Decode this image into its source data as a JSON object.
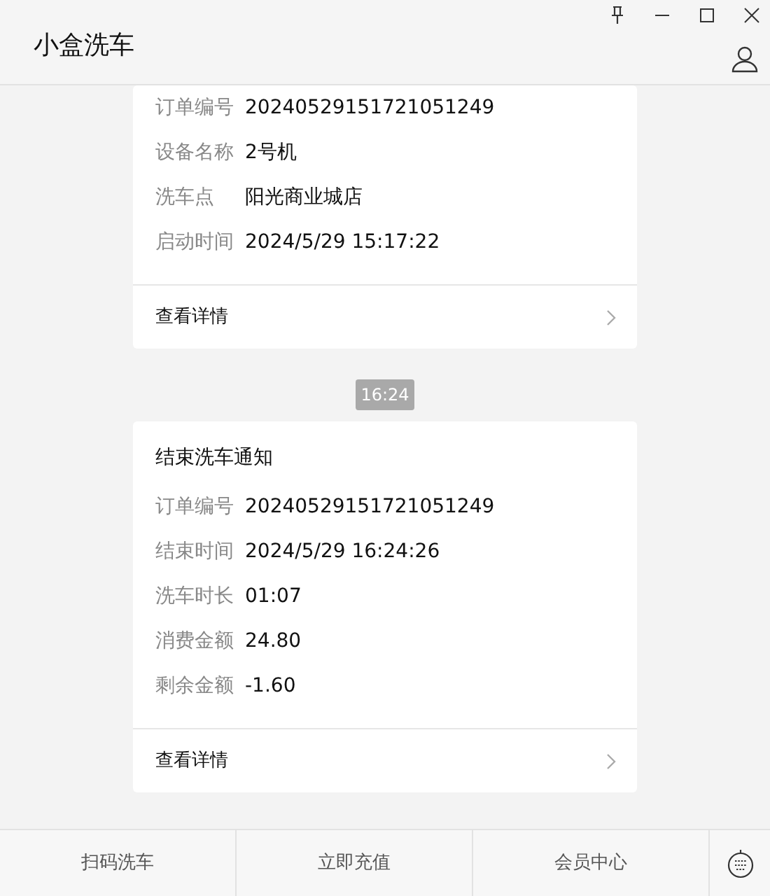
{
  "window": {
    "title": "小盒洗车"
  },
  "messages": [
    {
      "kind": "card",
      "rows": [
        {
          "label": "订单编号",
          "value": "20240529151721051249"
        },
        {
          "label": "设备名称",
          "value": "2号机"
        },
        {
          "label": "洗车点",
          "value": "阳光商业城店"
        },
        {
          "label": "启动时间",
          "value": "2024/5/29 15:17:22"
        }
      ],
      "link": "查看详情"
    },
    {
      "kind": "time",
      "text": "16:24"
    },
    {
      "kind": "card",
      "title": "结束洗车通知",
      "rows": [
        {
          "label": "订单编号",
          "value": "20240529151721051249"
        },
        {
          "label": "结束时间",
          "value": "2024/5/29 16:24:26"
        },
        {
          "label": "洗车时长",
          "value": "01:07"
        },
        {
          "label": "消费金额",
          "value": "24.80"
        },
        {
          "label": "剩余金额",
          "value": "-1.60"
        }
      ],
      "link": "查看详情"
    }
  ],
  "bottom_menu": [
    "扫码洗车",
    "立即充值",
    "会员中心"
  ]
}
